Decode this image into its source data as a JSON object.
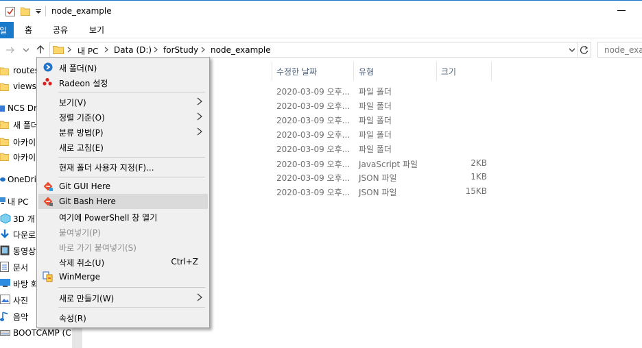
{
  "window": {
    "title": "node_example"
  },
  "ribbon": {
    "tabs": [
      "일",
      "홈",
      "공유",
      "보기"
    ]
  },
  "address": {
    "crumbs": [
      "내 PC",
      "Data (D:)",
      "forStudy",
      "node_example"
    ],
    "search_placeholder": "node_exam"
  },
  "nav": {
    "items": [
      "routes",
      "views",
      "NCS Dr",
      "새 폴더",
      "아카이",
      "아카이",
      "OneDriv",
      "내 PC",
      "3D 개",
      "다운로",
      "동영상",
      "문서",
      "바탕 화",
      "사진",
      "음악",
      "BOOTCAMP (C:"
    ]
  },
  "file_list": {
    "columns": [
      "수정한 날짜",
      "유형",
      "크기"
    ],
    "rows": [
      {
        "date": "2020-03-09 오후...",
        "type": "파일 폴더",
        "size": ""
      },
      {
        "date": "2020-03-09 오후...",
        "type": "파일 폴더",
        "size": ""
      },
      {
        "date": "2020-03-09 오후...",
        "type": "파일 폴더",
        "size": ""
      },
      {
        "date": "2020-03-09 오후...",
        "type": "파일 폴더",
        "size": ""
      },
      {
        "date": "2020-03-09 오후...",
        "type": "파일 폴더",
        "size": ""
      },
      {
        "date": "2020-03-09 오후...",
        "type": "JavaScript 파일",
        "size": "2KB"
      },
      {
        "date": "2020-03-09 오후...",
        "type": "JSON 파일",
        "size": "1KB"
      },
      {
        "date": "2020-03-09 오후...",
        "type": "JSON 파일",
        "size": "15KB"
      }
    ]
  },
  "context_menu": {
    "new_folder": "새 폴더(N)",
    "radeon": "Radeon 설정",
    "view": "보기(V)",
    "sort_by": "정렬 기준(O)",
    "group_by": "분류 방법(P)",
    "refresh": "새로 고침(E)",
    "customize": "현재 폴더 사용자 지정(F)...",
    "git_gui": "Git GUI Here",
    "git_bash": "Git Bash Here",
    "powershell": "여기에 PowerShell 창 열기",
    "paste": "붙여넣기(P)",
    "paste_shortcut": "바로 가기 붙여넣기(S)",
    "undo_delete": "삭제 취소(U)",
    "undo_shortcut": "Ctrl+Z",
    "winmerge": "WinMerge",
    "new": "새로 만들기(W)",
    "properties": "속성(R)"
  },
  "colors": {
    "accent": "#1979ca",
    "folder": "#ffd66b",
    "highlight": "#dadada"
  }
}
